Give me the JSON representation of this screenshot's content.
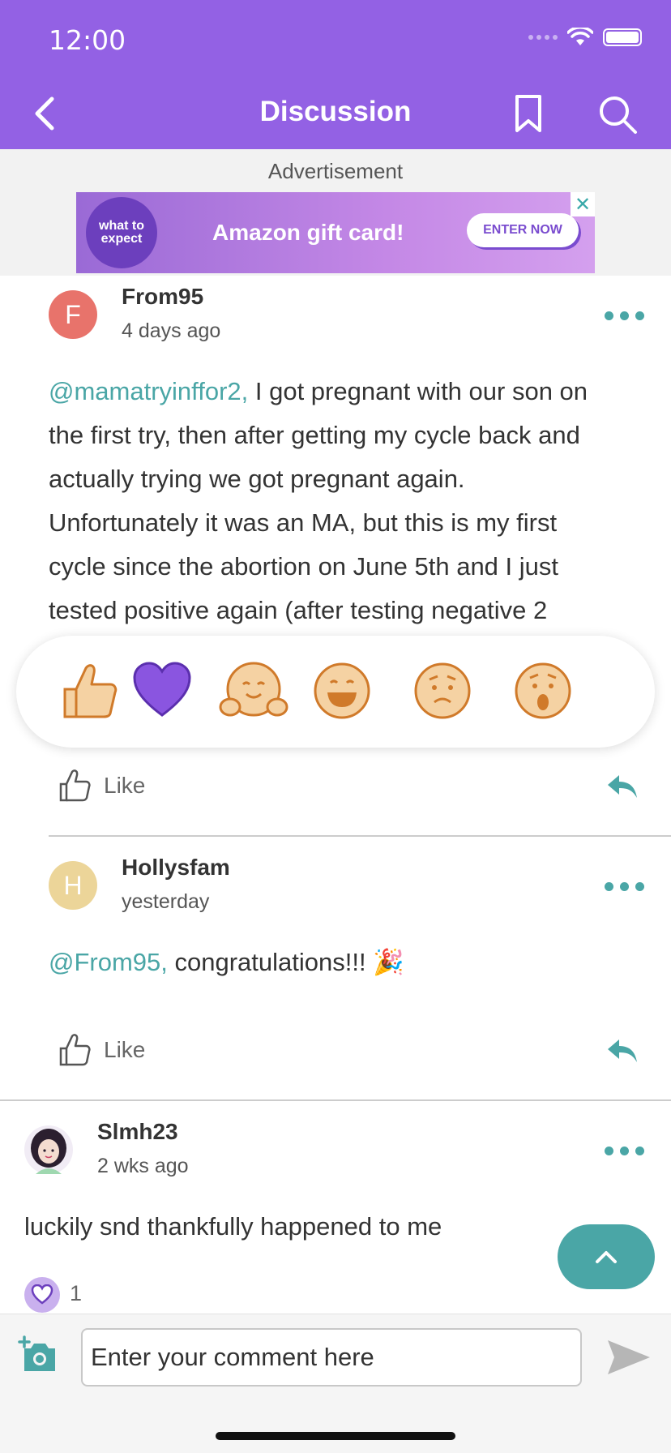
{
  "status_bar": {
    "time": "12:00"
  },
  "nav": {
    "title": "Discussion"
  },
  "ad": {
    "label": "Advertisement",
    "logo_text": "what to expect",
    "headline": "Amazon gift card!",
    "cta": "ENTER NOW",
    "close": "✕"
  },
  "posts": [
    {
      "avatar_letter": "F",
      "avatar_color": "#e8736b",
      "username": "From95",
      "time": "4 days ago",
      "mention": "@mamatryinffor2,",
      "text_line1": " I got pregnant with our son on",
      "text_rest": [
        "the first try, then after getting my cycle back and",
        "actually trying we got pregnant again.",
        "Unfortunately it was an MA, but this is my first",
        "cycle since the abortion on June 5th and I just",
        "tested positive again (after testing negative 2"
      ],
      "like_label": "Like"
    },
    {
      "avatar_letter": "H",
      "avatar_color": "#ecd599",
      "username": "Hollysfam",
      "time": "yesterday",
      "mention": "@From95,",
      "text": " congratulations!!! 🎉",
      "like_label": "Like"
    },
    {
      "username": "Slmh23",
      "time": "2 wks ago",
      "text": "luckily snd thankfully happened to me",
      "reaction_count": "1"
    }
  ],
  "composer": {
    "placeholder": "Enter your comment here"
  },
  "colors": {
    "brand_purple": "#9361e4",
    "accent_teal": "#4aa6a6"
  }
}
